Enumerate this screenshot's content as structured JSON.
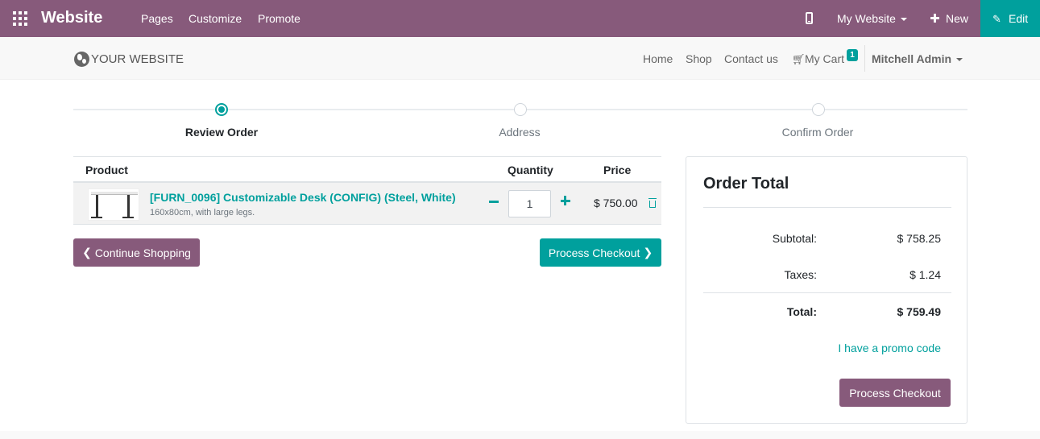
{
  "admin_bar": {
    "brand": "Website",
    "menu": [
      "Pages",
      "Customize",
      "Promote"
    ],
    "website_selector": "My Website",
    "new_label": "New",
    "edit_label": "Edit"
  },
  "site_header": {
    "logo_text": "YOUR WEBSITE",
    "nav": [
      "Home",
      "Shop",
      "Contact us"
    ],
    "cart_label": "My Cart",
    "cart_count": "1",
    "user_name": "Mitchell Admin"
  },
  "wizard": {
    "steps": [
      "Review Order",
      "Address",
      "Confirm Order"
    ],
    "active_step": 0
  },
  "cart": {
    "columns": {
      "product": "Product",
      "quantity": "Quantity",
      "price": "Price"
    },
    "lines": [
      {
        "name": "[FURN_0096] Customizable Desk (CONFIG) (Steel, White)",
        "description": "160x80cm, with large legs.",
        "quantity": "1",
        "price": "$ 750.00"
      }
    ]
  },
  "actions": {
    "continue_shopping": "Continue Shopping",
    "process_checkout": "Process Checkout"
  },
  "order_total": {
    "title": "Order Total",
    "subtotal_label": "Subtotal:",
    "subtotal_value": "$ 758.25",
    "taxes_label": "Taxes:",
    "taxes_value": "$ 1.24",
    "total_label": "Total:",
    "total_value": "$ 759.49",
    "promo_link": "I have a promo code",
    "checkout_label": "Process Checkout"
  },
  "colors": {
    "primary": "#875a7b",
    "accent": "#00a09d"
  }
}
